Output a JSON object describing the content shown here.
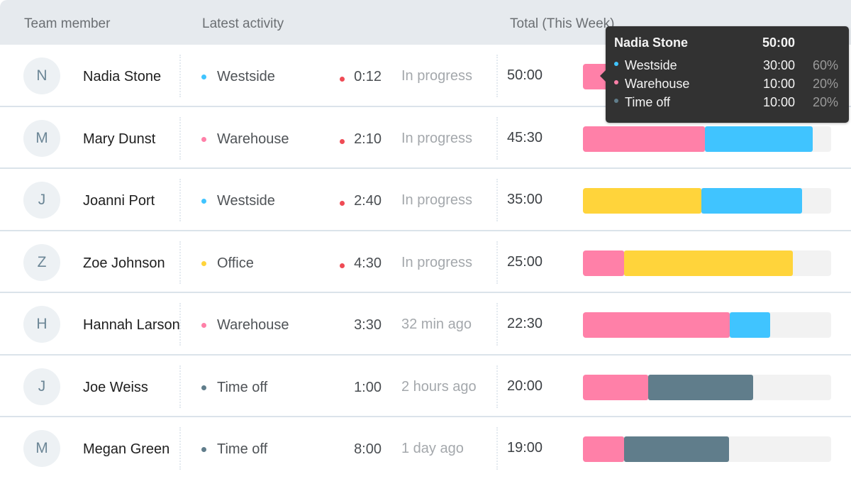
{
  "colors": {
    "westside": "#40c4ff",
    "warehouse": "#ff80a8",
    "office": "#ffd43b",
    "time_off": "#607d8b",
    "live": "#ef4b55"
  },
  "header": {
    "team_member": "Team member",
    "latest_activity": "Latest activity",
    "total": "Total (This Week)"
  },
  "rows": [
    {
      "initial": "N",
      "name": "Nadia Stone",
      "location": "Westside",
      "location_key": "westside",
      "live": true,
      "duration": "0:12",
      "status": "In progress",
      "total": "50:00",
      "segments": [
        {
          "key": "warehouse",
          "fraction": 0.2
        }
      ]
    },
    {
      "initial": "M",
      "name": "Mary Dunst",
      "location": "Warehouse",
      "location_key": "warehouse",
      "live": true,
      "duration": "2:10",
      "status": "In progress",
      "total": "45:30",
      "segments": [
        {
          "key": "warehouse",
          "fraction": 0.49
        },
        {
          "key": "westside",
          "fraction": 0.437
        }
      ]
    },
    {
      "initial": "J",
      "name": "Joanni Port",
      "location": "Westside",
      "location_key": "westside",
      "live": true,
      "duration": "2:40",
      "status": "In progress",
      "total": "35:00",
      "segments": [
        {
          "key": "office",
          "fraction": 0.477
        },
        {
          "key": "westside",
          "fraction": 0.406
        }
      ]
    },
    {
      "initial": "Z",
      "name": "Zoe Johnson",
      "location": "Office",
      "location_key": "office",
      "live": true,
      "duration": "4:30",
      "status": "In progress",
      "total": "25:00",
      "segments": [
        {
          "key": "warehouse",
          "fraction": 0.166
        },
        {
          "key": "office",
          "fraction": 0.68
        }
      ]
    },
    {
      "initial": "H",
      "name": "Hannah Larson",
      "location": "Warehouse",
      "location_key": "warehouse",
      "live": false,
      "duration": "3:30",
      "status": "32 min ago",
      "total": "22:30",
      "segments": [
        {
          "key": "warehouse",
          "fraction": 0.591
        },
        {
          "key": "westside",
          "fraction": 0.163
        }
      ]
    },
    {
      "initial": "J",
      "name": "Joe Weiss",
      "location": "Time off",
      "location_key": "time_off",
      "live": false,
      "duration": "1:00",
      "status": "2 hours ago",
      "total": "20:00",
      "segments": [
        {
          "key": "warehouse",
          "fraction": 0.263
        },
        {
          "key": "time_off",
          "fraction": 0.423
        }
      ]
    },
    {
      "initial": "M",
      "name": "Megan Green",
      "location": "Time off",
      "location_key": "time_off",
      "live": false,
      "duration": "8:00",
      "status": "1 day ago",
      "total": "19:00",
      "segments": [
        {
          "key": "warehouse",
          "fraction": 0.166
        },
        {
          "key": "time_off",
          "fraction": 0.423
        }
      ]
    }
  ],
  "tooltip": {
    "name": "Nadia Stone",
    "total": "50:00",
    "items": [
      {
        "label": "Westside",
        "key": "westside",
        "value": "30:00",
        "percent": "60%"
      },
      {
        "label": "Warehouse",
        "key": "warehouse",
        "value": "10:00",
        "percent": "20%"
      },
      {
        "label": "Time off",
        "key": "time_off",
        "value": "10:00",
        "percent": "20%"
      }
    ]
  }
}
